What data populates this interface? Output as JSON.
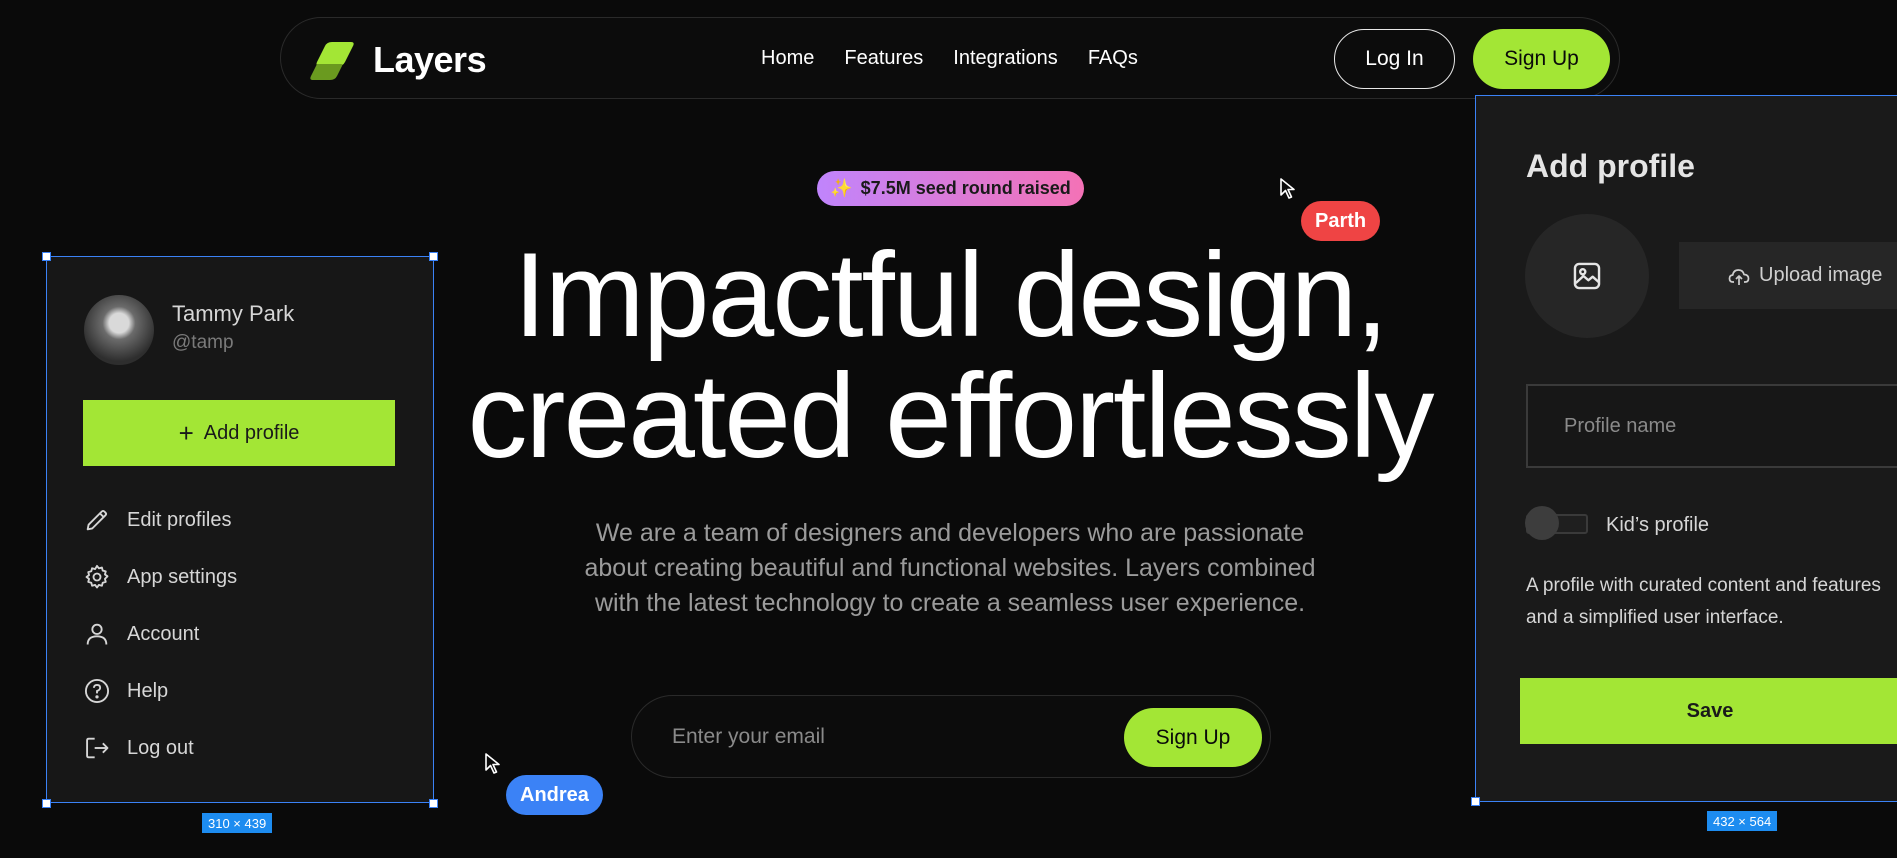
{
  "nav": {
    "brand": "Layers",
    "links": [
      "Home",
      "Features",
      "Integrations",
      "FAQs"
    ],
    "login_label": "Log In",
    "signup_label": "Sign Up"
  },
  "hero": {
    "badge_icon": "sparkles-icon",
    "badge_text": "$7.5M seed round raised",
    "headline_line1": "Impactful design,",
    "headline_line2": "created effortlessly",
    "subtext": "We are a team of designers and developers who are passionate about creating beautiful and functional websites. Layers combined with the latest technology to create a seamless user experience.",
    "email_placeholder": "Enter your email",
    "email_signup_label": "Sign Up"
  },
  "cursors": [
    {
      "name": "Parth",
      "color": "#ef4444"
    },
    {
      "name": "Andrea",
      "color": "#3b82f6"
    }
  ],
  "left_card": {
    "user_name": "Tammy Park",
    "user_handle": "@tamp",
    "add_profile_label": "Add profile",
    "menu": [
      {
        "label": "Edit profiles",
        "icon": "pencil-icon"
      },
      {
        "label": "App settings",
        "icon": "gear-icon"
      },
      {
        "label": "Account",
        "icon": "user-icon"
      },
      {
        "label": "Help",
        "icon": "help-circle-icon"
      },
      {
        "label": "Log out",
        "icon": "logout-icon"
      }
    ],
    "dimensions_label": "310 × 439"
  },
  "right_card": {
    "title": "Add profile",
    "upload_label": "Upload image",
    "profile_name_placeholder": "Profile name",
    "kids_toggle_label": "Kid’s profile",
    "description_line1": "A profile with curated content and features",
    "description_line2": "and a simplified user interface.",
    "save_label": "Save",
    "dimensions_label": "432 × 564"
  },
  "colors": {
    "accent": "#a3e635",
    "background": "#0a0a0a",
    "selection": "#3b82f6",
    "badge_gradient_start": "#c084fc",
    "badge_gradient_end": "#f472b6"
  }
}
